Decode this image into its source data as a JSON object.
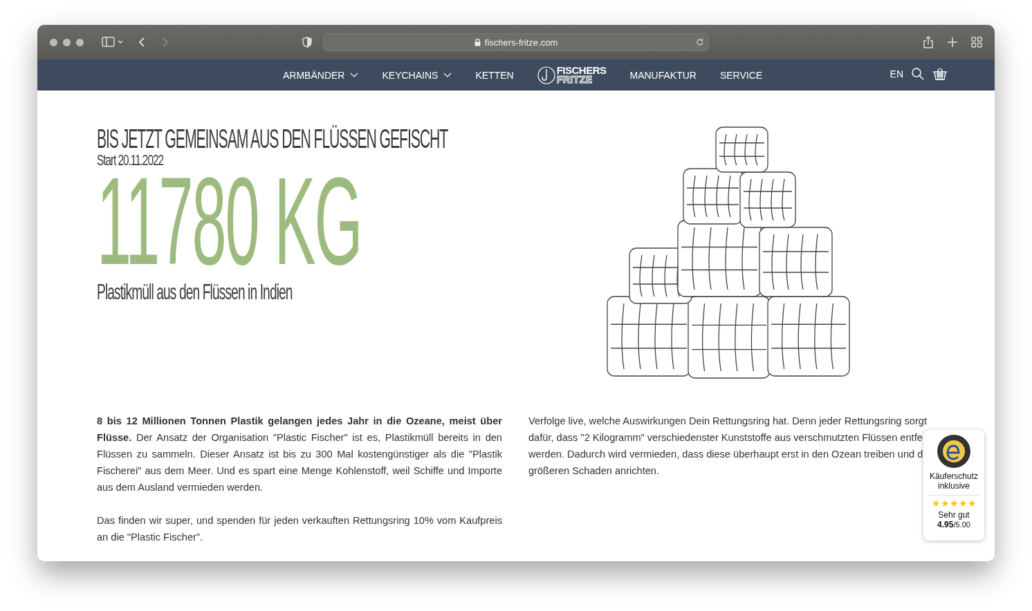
{
  "browser": {
    "url": "fischers-fritze.com"
  },
  "nav": {
    "items": [
      {
        "label": "ARMBÄNDER",
        "dropdown": true
      },
      {
        "label": "KEYCHAINS",
        "dropdown": true
      },
      {
        "label": "KETTEN",
        "dropdown": false
      },
      {
        "kind": "logo",
        "line1": "FISCHERS",
        "line2": "FRITZE"
      },
      {
        "label": "MANUFAKTUR",
        "dropdown": false
      },
      {
        "label": "SERVICE",
        "dropdown": false
      }
    ],
    "language": "EN"
  },
  "hero": {
    "heading": "BIS JETZT GEMEINSAM AUS DEN FLÜSSEN GEFISCHT",
    "start": "Start 20.11.2022",
    "amount": "11780 KG",
    "caption": "Plastikmüll aus den Flüssen in Indien"
  },
  "left_column": [
    "**8 bis 12 Millionen Tonnen Plastik gelangen jedes Jahr in die Ozeane, meist über Flüsse.** Der Ansatz der Organisation \"Plastic Fischer\" ist es, Plastikmüll bereits in den Flüssen zu sammeln. Dieser Ansatz ist bis zu 300 Mal kostengünstiger als die \"Plastik Fischerei\" aus dem Meer. Und es spart eine Menge Kohlenstoff, weil Schiffe und Importe aus dem Ausland vermieden werden.",
    "Das finden wir super, und spenden für jeden verkauften Rettungsring 10% vom Kaufpreis an die \"Plastic Fischer\"."
  ],
  "right_column": [
    "Verfolge live, welche Auswirkungen Dein Rettungsring hat. Denn jeder Rettungsring sorgt dafür, dass \"2 Kilogramm\" verschiedenster Kunststoffe aus verschmutzten Flüssen entfe werden. Dadurch wird vermieden, dass diese überhaupt erst in den Ozean treiben und d größeren Schaden anrichten."
  ],
  "trust_badge": {
    "title": "Käuferschutz inklusive",
    "stars": 5,
    "rating_text": "Sehr gut",
    "score": "4.95",
    "max": "/5.00"
  }
}
